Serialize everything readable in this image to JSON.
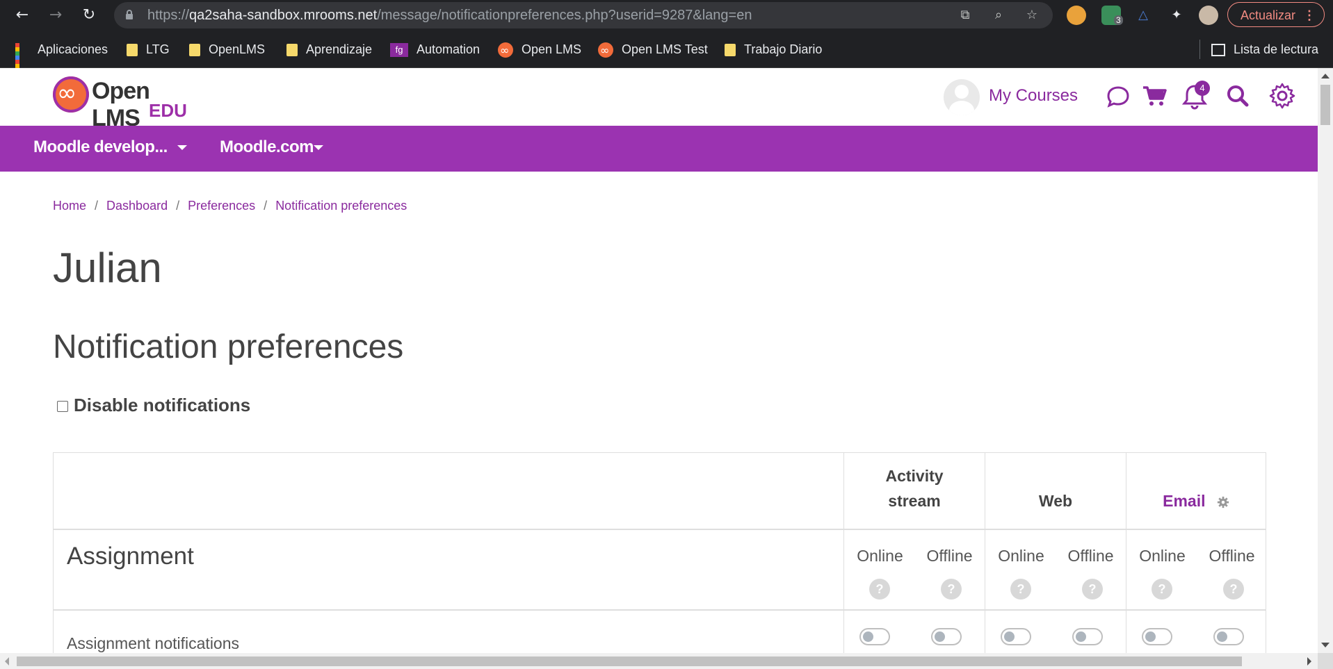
{
  "browser": {
    "url_prefix": "https://",
    "url_host": "qa2saha-sandbox.mrooms.net",
    "url_path": "/message/notificationpreferences.php?userid=9287&lang=en",
    "update_label": "Actualizar",
    "extension_badge": "3",
    "bookmarks": [
      {
        "label": "Aplicaciones",
        "icon": "apps-grid-icon"
      },
      {
        "label": "LTG",
        "icon": "folder-icon"
      },
      {
        "label": "OpenLMS",
        "icon": "folder-icon"
      },
      {
        "label": "Aprendizaje",
        "icon": "folder-icon"
      },
      {
        "label": "Automation",
        "icon": "automation-icon"
      },
      {
        "label": "Open LMS",
        "icon": "openlms-icon"
      },
      {
        "label": "Open LMS Test",
        "icon": "openlms-icon"
      },
      {
        "label": "Trabajo Diario",
        "icon": "folder-icon"
      }
    ],
    "reading_list_label": "Lista de lectura"
  },
  "header": {
    "logo_name": "Open LMS",
    "logo_sub": "EDU",
    "my_courses": "My Courses",
    "notification_count": "4"
  },
  "navbar": {
    "items": [
      "Moodle develop...",
      "Moodle.com"
    ]
  },
  "breadcrumb": [
    "Home",
    "Dashboard",
    "Preferences",
    "Notification preferences"
  ],
  "page": {
    "user_name": "Julian",
    "title": "Notification preferences",
    "disable_label": "Disable notifications"
  },
  "prefs_table": {
    "processors": [
      {
        "label_line1": "Activity",
        "label_line2": "stream"
      },
      {
        "label_line1": "",
        "label_line2": "Web"
      },
      {
        "label_line1": "",
        "label_line2": "Email"
      }
    ],
    "states": [
      "Online",
      "Offline"
    ],
    "help_mark": "?",
    "component": "Assignment",
    "items": [
      {
        "label": "Assignment notifications"
      }
    ]
  },
  "colors": {
    "brand_purple": "#9b33b1",
    "link_purple": "#8a2a9e",
    "logo_orange": "#f26b3a",
    "chrome_dark": "#202124",
    "update_red": "#f28b82"
  }
}
